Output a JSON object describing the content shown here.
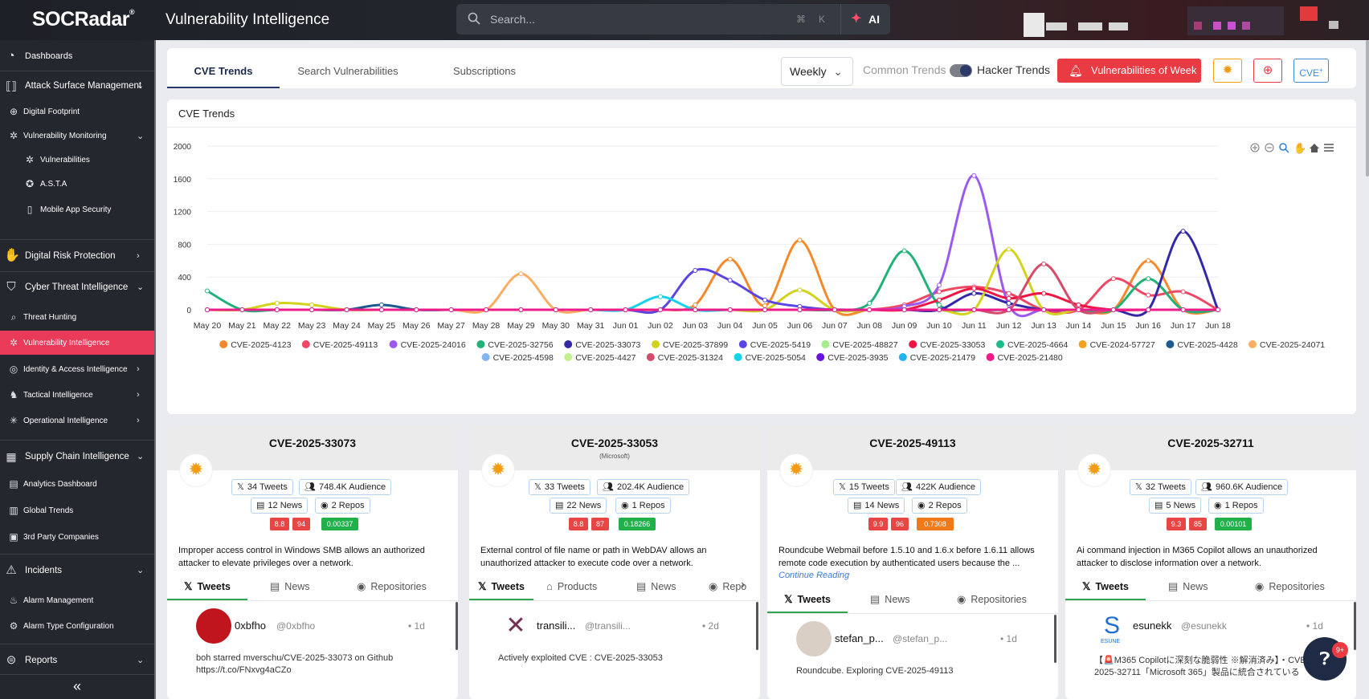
{
  "app": {
    "logo": "SOCRadar",
    "title": "Vulnerability Intelligence"
  },
  "search": {
    "placeholder": "Search...",
    "shortcut_key1": "⌘",
    "shortcut_key2": "K",
    "ai_label": "AI"
  },
  "sidebar": {
    "items": [
      {
        "label": "Dashboards",
        "icon": "dashboard-icon"
      },
      {
        "label": "Attack Surface Management",
        "icon": "attack-surface-icon"
      },
      {
        "label": "Digital Footprint",
        "icon": "footprint-icon"
      },
      {
        "label": "Vulnerability Monitoring",
        "icon": "bug-icon"
      },
      {
        "label": "Vulnerabilities",
        "icon": "bug-icon"
      },
      {
        "label": "A.S.T.A",
        "icon": "asta-icon"
      },
      {
        "label": "Mobile App Security",
        "icon": "mobile-icon"
      },
      {
        "label": "Digital Risk Protection",
        "icon": "hand-icon"
      },
      {
        "label": "Cyber Threat Intelligence",
        "icon": "shield-icon"
      },
      {
        "label": "Threat Hunting",
        "icon": "search-icon"
      },
      {
        "label": "Vulnerability Intelligence",
        "icon": "bug-icon"
      },
      {
        "label": "Identity & Access Intelligence",
        "icon": "identity-icon"
      },
      {
        "label": "Tactical Intelligence",
        "icon": "tactical-icon"
      },
      {
        "label": "Operational Intelligence",
        "icon": "operational-icon"
      },
      {
        "label": "Supply Chain Intelligence",
        "icon": "supply-chain-icon"
      },
      {
        "label": "Analytics Dashboard",
        "icon": "analytics-icon"
      },
      {
        "label": "Global Trends",
        "icon": "chart-icon"
      },
      {
        "label": "3rd Party Companies",
        "icon": "building-icon"
      },
      {
        "label": "Incidents",
        "icon": "incident-icon"
      },
      {
        "label": "Alarm Management",
        "icon": "alarm-icon"
      },
      {
        "label": "Alarm Type Configuration",
        "icon": "alarm-config-icon"
      },
      {
        "label": "Reports",
        "icon": "reports-icon"
      }
    ],
    "collapse": "«"
  },
  "tabs": [
    "CVE Trends",
    "Search Vulnerabilities",
    "Subscriptions"
  ],
  "controls": {
    "period": "Weekly",
    "common_label": "Common Trends",
    "hacker_label": "Hacker Trends",
    "hacker_trends_on": true,
    "vuln_week": "Vulnerabilities of Week",
    "cve_btn": "CVE",
    "cve_sup": "+"
  },
  "chart_title": "CVE Trends",
  "chart_data": {
    "type": "line",
    "title": "CVE Trends",
    "ylim": [
      0,
      2000
    ],
    "yticks": [
      0,
      400,
      800,
      1200,
      1600,
      2000
    ],
    "categories": [
      "May 20",
      "May 21",
      "May 22",
      "May 23",
      "May 24",
      "May 25",
      "May 26",
      "May 27",
      "May 28",
      "May 29",
      "May 30",
      "May 31",
      "Jun 01",
      "Jun 02",
      "Jun 03",
      "Jun 04",
      "Jun 05",
      "Jun 06",
      "Jun 07",
      "Jun 08",
      "Jun 09",
      "Jun 10",
      "Jun 11",
      "Jun 12",
      "Jun 13",
      "Jun 14",
      "Jun 15",
      "Jun 16",
      "Jun 17",
      "Jun 18"
    ],
    "legend_placement": "bottom",
    "series": [
      {
        "name": "CVE-2025-4123",
        "color": "#f7892b",
        "values": [
          0,
          0,
          0,
          0,
          0,
          0,
          0,
          0,
          0,
          0,
          0,
          0,
          0,
          0,
          60,
          620,
          50,
          850,
          0,
          0,
          0,
          0,
          0,
          0,
          0,
          0,
          0,
          600,
          0,
          0
        ]
      },
      {
        "name": "CVE-2025-49113",
        "color": "#ef4865",
        "values": [
          0,
          0,
          0,
          0,
          0,
          0,
          0,
          0,
          0,
          0,
          0,
          0,
          0,
          0,
          0,
          0,
          0,
          0,
          0,
          0,
          60,
          220,
          280,
          200,
          0,
          0,
          380,
          180,
          220,
          0
        ]
      },
      {
        "name": "CVE-2025-24016",
        "color": "#9c59ee",
        "values": [
          0,
          0,
          0,
          0,
          0,
          0,
          0,
          0,
          0,
          0,
          0,
          0,
          0,
          0,
          0,
          0,
          0,
          0,
          0,
          0,
          40,
          300,
          1640,
          60,
          0,
          0,
          0,
          0,
          0,
          0
        ]
      },
      {
        "name": "CVE-2025-32756",
        "color": "#22b279",
        "values": [
          230,
          0,
          0,
          0,
          0,
          0,
          0,
          0,
          0,
          0,
          0,
          0,
          0,
          0,
          0,
          0,
          0,
          0,
          0,
          80,
          720,
          60,
          0,
          0,
          0,
          0,
          0,
          380,
          0,
          0
        ]
      },
      {
        "name": "CVE-2025-33073",
        "color": "#3328a8",
        "values": [
          0,
          0,
          0,
          0,
          0,
          0,
          0,
          0,
          0,
          0,
          0,
          0,
          0,
          0,
          0,
          0,
          0,
          0,
          0,
          0,
          0,
          0,
          200,
          80,
          0,
          0,
          0,
          0,
          960,
          0
        ]
      },
      {
        "name": "CVE-2025-37899",
        "color": "#d3d21d",
        "values": [
          0,
          0,
          80,
          60,
          0,
          0,
          0,
          0,
          0,
          0,
          0,
          0,
          0,
          0,
          0,
          0,
          0,
          240,
          0,
          0,
          0,
          0,
          0,
          740,
          0,
          0,
          0,
          0,
          0,
          0
        ]
      },
      {
        "name": "CVE-2025-5419",
        "color": "#5b45e2",
        "values": [
          0,
          0,
          0,
          0,
          0,
          0,
          0,
          0,
          0,
          0,
          0,
          0,
          0,
          0,
          480,
          360,
          120,
          40,
          0,
          0,
          0,
          0,
          0,
          0,
          0,
          0,
          0,
          0,
          0,
          0
        ]
      },
      {
        "name": "CVE-2025-48827",
        "color": "#a3ee86",
        "values": [
          0,
          0,
          0,
          0,
          0,
          0,
          0,
          0,
          0,
          0,
          0,
          0,
          0,
          0,
          0,
          0,
          0,
          0,
          0,
          0,
          0,
          0,
          0,
          0,
          0,
          0,
          0,
          0,
          0,
          0
        ]
      },
      {
        "name": "CVE-2025-33053",
        "color": "#ee1644",
        "values": [
          0,
          0,
          0,
          0,
          0,
          0,
          0,
          0,
          0,
          0,
          0,
          0,
          0,
          0,
          0,
          0,
          0,
          0,
          0,
          0,
          0,
          120,
          260,
          140,
          200,
          60,
          0,
          0,
          0,
          0
        ]
      },
      {
        "name": "CVE-2025-4664",
        "color": "#1fba8a",
        "values": [
          0,
          0,
          0,
          0,
          0,
          0,
          0,
          0,
          0,
          0,
          0,
          0,
          0,
          0,
          0,
          0,
          0,
          0,
          0,
          0,
          0,
          0,
          0,
          0,
          0,
          0,
          0,
          0,
          0,
          0
        ]
      },
      {
        "name": "CVE-2024-57727",
        "color": "#f5a11a",
        "values": [
          0,
          0,
          0,
          0,
          0,
          0,
          0,
          0,
          0,
          0,
          0,
          0,
          0,
          0,
          0,
          0,
          0,
          0,
          0,
          0,
          0,
          0,
          0,
          0,
          0,
          0,
          0,
          0,
          0,
          0
        ]
      },
      {
        "name": "CVE-2025-4428",
        "color": "#1f5a8e",
        "values": [
          0,
          0,
          0,
          0,
          0,
          60,
          0,
          0,
          0,
          0,
          0,
          0,
          0,
          0,
          0,
          0,
          0,
          0,
          0,
          0,
          0,
          0,
          0,
          0,
          0,
          0,
          0,
          0,
          0,
          0
        ]
      },
      {
        "name": "CVE-2025-24071",
        "color": "#fbad63",
        "values": [
          0,
          0,
          0,
          0,
          0,
          0,
          0,
          0,
          0,
          440,
          0,
          0,
          0,
          0,
          0,
          0,
          0,
          0,
          0,
          0,
          0,
          0,
          0,
          0,
          0,
          0,
          0,
          0,
          0,
          0
        ]
      },
      {
        "name": "CVE-2025-4598",
        "color": "#82b6f0",
        "values": [
          0,
          0,
          0,
          0,
          0,
          0,
          0,
          0,
          0,
          0,
          0,
          0,
          0,
          0,
          0,
          0,
          0,
          0,
          0,
          0,
          0,
          0,
          0,
          0,
          0,
          0,
          0,
          0,
          0,
          0
        ]
      },
      {
        "name": "CVE-2025-4427",
        "color": "#c5ef8d",
        "values": [
          0,
          0,
          0,
          0,
          0,
          0,
          0,
          0,
          0,
          0,
          0,
          0,
          0,
          0,
          0,
          0,
          0,
          0,
          0,
          0,
          0,
          0,
          0,
          0,
          0,
          0,
          0,
          0,
          0,
          0
        ]
      },
      {
        "name": "CVE-2025-31324",
        "color": "#d54c6b",
        "values": [
          0,
          0,
          0,
          0,
          0,
          0,
          0,
          0,
          0,
          0,
          0,
          0,
          0,
          0,
          0,
          0,
          0,
          0,
          0,
          0,
          0,
          0,
          0,
          0,
          560,
          0,
          0,
          0,
          0,
          0
        ]
      },
      {
        "name": "CVE-2025-5054",
        "color": "#17d2e8",
        "values": [
          0,
          0,
          0,
          0,
          0,
          0,
          0,
          0,
          0,
          0,
          0,
          0,
          0,
          160,
          0,
          0,
          0,
          0,
          0,
          0,
          0,
          0,
          0,
          0,
          0,
          0,
          0,
          0,
          0,
          0
        ]
      },
      {
        "name": "CVE-2025-3935",
        "color": "#6a12e1",
        "values": [
          0,
          0,
          0,
          0,
          0,
          0,
          0,
          0,
          0,
          0,
          0,
          0,
          0,
          0,
          0,
          0,
          0,
          0,
          0,
          0,
          0,
          0,
          0,
          0,
          0,
          0,
          0,
          0,
          0,
          0
        ]
      },
      {
        "name": "CVE-2025-21479",
        "color": "#1fb4ee",
        "values": [
          0,
          0,
          0,
          0,
          0,
          0,
          0,
          0,
          0,
          0,
          0,
          0,
          0,
          0,
          0,
          0,
          0,
          0,
          0,
          0,
          0,
          0,
          0,
          0,
          0,
          0,
          0,
          0,
          0,
          0
        ]
      },
      {
        "name": "CVE-2025-21480",
        "color": "#ee1c8a",
        "values": [
          0,
          0,
          0,
          0,
          0,
          0,
          0,
          0,
          0,
          0,
          0,
          0,
          0,
          0,
          0,
          0,
          0,
          0,
          0,
          0,
          0,
          0,
          0,
          0,
          0,
          0,
          0,
          0,
          0,
          0
        ]
      }
    ]
  },
  "cards": [
    {
      "cve": "CVE-2025-33073",
      "vendor": "",
      "tweets": "34 Tweets",
      "audience": "748.4K Audience",
      "news": "12 News",
      "repos": "2 Repos",
      "scores": [
        {
          "v": "8.8",
          "c": "#e84545"
        },
        {
          "v": "94",
          "c": "#e84545"
        },
        {
          "v": "0.00337",
          "c": "#22b04a"
        }
      ],
      "desc": "Improper access control in Windows SMB allows an authorized attacker to elevate privileges over a network.",
      "continue": "",
      "tabs": [
        "Tweets",
        "News",
        "Repositories"
      ],
      "tweet": {
        "name": "0xbfho",
        "handle": "@0xbfho",
        "age": "1d",
        "text": "boh starred mverschu/CVE-2025-33073 on Github",
        "text2": "https://t.co/FNxvg4aCZo"
      }
    },
    {
      "cve": "CVE-2025-33053",
      "vendor": "(Microsoft)",
      "tweets": "33 Tweets",
      "audience": "202.4K Audience",
      "news": "22 News",
      "repos": "1 Repos",
      "scores": [
        {
          "v": "8.8",
          "c": "#e84545"
        },
        {
          "v": "87",
          "c": "#e84545"
        },
        {
          "v": "0.18266",
          "c": "#22b04a"
        }
      ],
      "desc": "External control of file name or path in WebDAV allows an unauthorized attacker to execute code over a network.",
      "continue": "",
      "tabs": [
        "Tweets",
        "Products",
        "News",
        "Repo"
      ],
      "tweet": {
        "name": "transili...",
        "handle": "@transili...",
        "age": "2d",
        "text": "Actively exploited CVE : CVE-2025-33053",
        "text2": ""
      }
    },
    {
      "cve": "CVE-2025-49113",
      "vendor": "",
      "tweets": "15 Tweets",
      "audience": "422K Audience",
      "news": "14 News",
      "repos": "2 Repos",
      "scores": [
        {
          "v": "9.9",
          "c": "#e84545"
        },
        {
          "v": "96",
          "c": "#e84545"
        },
        {
          "v": "0.7308",
          "c": "#f07a1a"
        }
      ],
      "desc": "Roundcube Webmail before 1.5.10 and 1.6.x before 1.6.11 allows remote code execution by authenticated users because the ...",
      "continue": "Continue Reading",
      "tabs": [
        "Tweets",
        "News",
        "Repositories"
      ],
      "tweet": {
        "name": "stefan_p...",
        "handle": "@stefan_p...",
        "age": "1d",
        "text": "Roundcube. Exploring CVE-2025-49113",
        "text2": ""
      }
    },
    {
      "cve": "CVE-2025-32711",
      "vendor": "",
      "tweets": "32 Tweets",
      "audience": "960.6K Audience",
      "news": "5 News",
      "repos": "1 Repos",
      "scores": [
        {
          "v": "9.3",
          "c": "#e84545"
        },
        {
          "v": "85",
          "c": "#e84545"
        },
        {
          "v": "0.00101",
          "c": "#22b04a"
        }
      ],
      "desc": "Ai command injection in M365 Copilot allows an unauthorized attacker to disclose information over a network.",
      "continue": "",
      "tabs": [
        "Tweets",
        "News",
        "Repositories"
      ],
      "tweet": {
        "name": "esunekk",
        "handle": "@esunekk",
        "age": "1d",
        "text": "【🚨M365 Copilotに深刻な脆弱性 ※解消済み】・CVE-",
        "text2": "2025-32711「Microsoft 365」製品に統合されている"
      }
    }
  ],
  "help_badge": "9+",
  "esune_label": "ESUNE"
}
